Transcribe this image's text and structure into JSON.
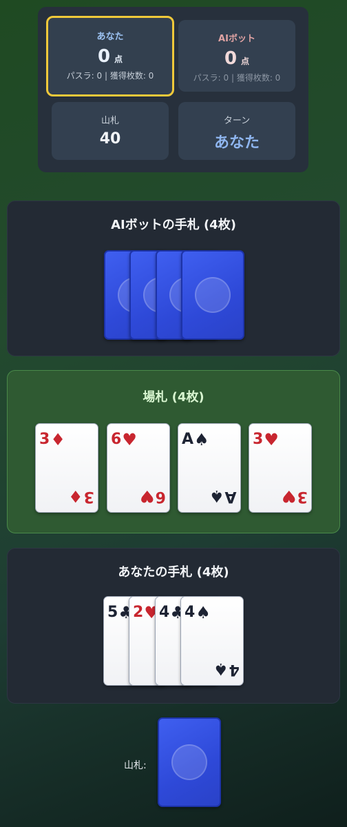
{
  "scoreboard": {
    "you": {
      "name": "あなた",
      "score": "0",
      "unit": "点",
      "stats": "パスラ: 0 | 獲得枚数: 0"
    },
    "ai": {
      "name": "AIボット",
      "score": "0",
      "unit": "点",
      "stats": "パスラ: 0 | 獲得枚数: 0"
    },
    "deck": {
      "label": "山札",
      "value": "40"
    },
    "turn": {
      "label": "ターン",
      "value": "あなた"
    }
  },
  "ai_hand": {
    "title": "AIボットの手札 (4枚)"
  },
  "field": {
    "title": "場札 (4枚)",
    "cards": [
      {
        "rank": "3",
        "suit": "♦",
        "color": "red"
      },
      {
        "rank": "6",
        "suit": "♥",
        "color": "red"
      },
      {
        "rank": "A",
        "suit": "♠",
        "color": "black"
      },
      {
        "rank": "3",
        "suit": "♥",
        "color": "red"
      }
    ]
  },
  "your_hand": {
    "title": "あなたの手札 (4枚)",
    "cards": [
      {
        "rank": "5",
        "suit": "♣",
        "color": "black"
      },
      {
        "rank": "2",
        "suit": "♥",
        "color": "red"
      },
      {
        "rank": "4",
        "suit": "♣",
        "color": "black"
      },
      {
        "rank": "4",
        "suit": "♠",
        "color": "black"
      }
    ]
  },
  "deck_pile": {
    "label": "山札:"
  },
  "colors": {
    "highlight": "#f0c93a",
    "card_back": "#3450e0",
    "field_bg": "#2f5a32"
  }
}
